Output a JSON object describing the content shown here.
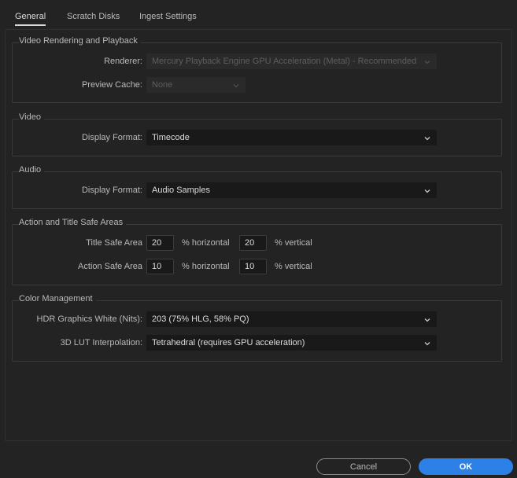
{
  "tabs": [
    {
      "label": "General"
    },
    {
      "label": "Scratch Disks"
    },
    {
      "label": "Ingest Settings"
    }
  ],
  "groups": {
    "video_rendering": {
      "title": "Video Rendering and Playback",
      "renderer_label": "Renderer:",
      "renderer_value": "Mercury Playback Engine GPU Acceleration (Metal) - Recommended",
      "preview_cache_label": "Preview Cache:",
      "preview_cache_value": "None"
    },
    "video": {
      "title": "Video",
      "display_format_label": "Display Format:",
      "display_format_value": "Timecode"
    },
    "audio": {
      "title": "Audio",
      "display_format_label": "Display Format:",
      "display_format_value": "Audio Samples"
    },
    "safe_areas": {
      "title": "Action and Title Safe Areas",
      "title_safe_label": "Title Safe Area",
      "title_safe_h": "20",
      "title_safe_v": "20",
      "action_safe_label": "Action Safe Area",
      "action_safe_h": "10",
      "action_safe_v": "10",
      "horizontal_unit": "% horizontal",
      "vertical_unit": "% vertical"
    },
    "color_management": {
      "title": "Color Management",
      "hdr_white_label": "HDR Graphics White (Nits):",
      "hdr_white_value": "203 (75% HLG, 58% PQ)",
      "lut_label": "3D LUT Interpolation:",
      "lut_value": "Tetrahedral (requires GPU acceleration)"
    }
  },
  "buttons": {
    "cancel": "Cancel",
    "ok": "OK"
  },
  "colors": {
    "background": "#232323",
    "accent": "#2d80e6"
  }
}
